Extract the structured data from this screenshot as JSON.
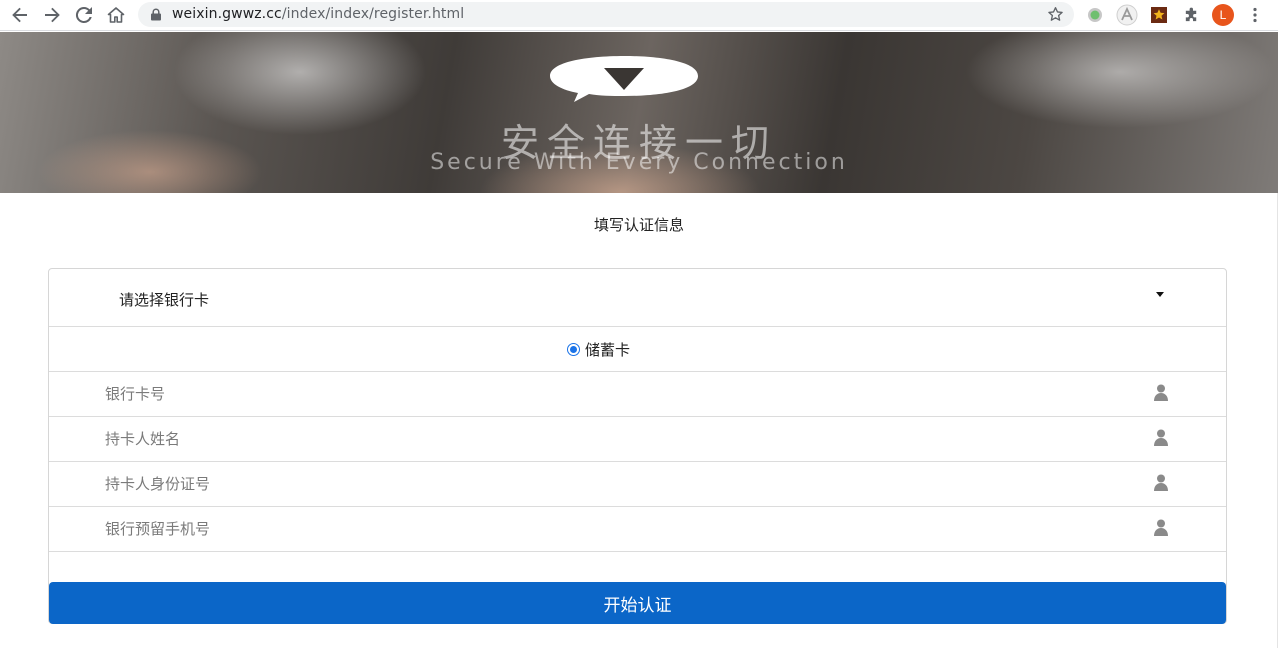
{
  "browser": {
    "url_host": "weixin.gwwz.cc",
    "url_path": "/index/index/register.html",
    "profile_initial": "L",
    "icons": [
      "back-arrow-icon",
      "forward-arrow-icon",
      "reload-icon",
      "home-icon",
      "lock-icon",
      "bookmark-star-icon",
      "extension-green-icon",
      "extension-a-icon",
      "extension-star-icon",
      "puzzle-icon",
      "menu-dots-icon"
    ]
  },
  "banner": {
    "title_cn": "安全连接一切",
    "title_en": "Secure With Every Connection"
  },
  "form": {
    "title": "填写认证信息",
    "bank_select_label": "请选择银行卡",
    "card_type_option": "储蓄卡",
    "fields": [
      {
        "placeholder": "银行卡号",
        "icon": "user-icon"
      },
      {
        "placeholder": "持卡人姓名",
        "icon": "user-icon"
      },
      {
        "placeholder": "持卡人身份证号",
        "icon": "user-icon"
      },
      {
        "placeholder": "银行预留手机号",
        "icon": "user-icon"
      }
    ],
    "submit_label": "开始认证"
  },
  "colors": {
    "primary_button": "#0b66c8",
    "radio_accent": "#1a73e8"
  }
}
